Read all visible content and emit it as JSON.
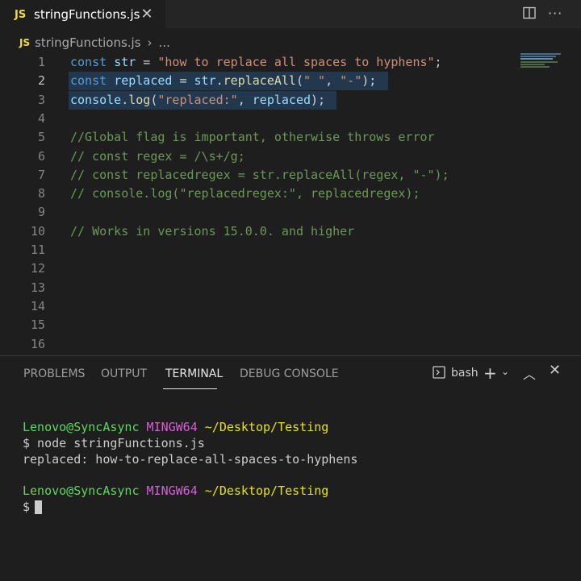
{
  "tab": {
    "badge": "JS",
    "filename": "stringFunctions.js",
    "close_icon": "close-icon"
  },
  "actions": {
    "split_icon": "split-editor-icon",
    "more_icon": "more-actions-icon"
  },
  "breadcrumb": {
    "badge": "JS",
    "file": "stringFunctions.js",
    "ellipsis": "..."
  },
  "editor": {
    "active_line": 2,
    "lines": [
      {
        "n": "1",
        "tokens": [
          {
            "t": "const",
            "c": "kw"
          },
          {
            "t": " ",
            "c": "pl"
          },
          {
            "t": "str",
            "c": "var"
          },
          {
            "t": " = ",
            "c": "pl"
          },
          {
            "t": "\"how to replace all spaces to hyphens\"",
            "c": "str"
          },
          {
            "t": ";",
            "c": "pl"
          }
        ]
      },
      {
        "n": "2",
        "tokens": [
          {
            "t": "const",
            "c": "kw"
          },
          {
            "t": " ",
            "c": "pl"
          },
          {
            "t": "replaced",
            "c": "var"
          },
          {
            "t": " = ",
            "c": "pl"
          },
          {
            "t": "str",
            "c": "var"
          },
          {
            "t": ".",
            "c": "pl"
          },
          {
            "t": "replaceAll",
            "c": "fn"
          },
          {
            "t": "(",
            "c": "pl"
          },
          {
            "t": "\" \"",
            "c": "str"
          },
          {
            "t": ", ",
            "c": "pl"
          },
          {
            "t": "\"-\"",
            "c": "str"
          },
          {
            "t": ");",
            "c": "pl"
          }
        ]
      },
      {
        "n": "3",
        "tokens": [
          {
            "t": "console",
            "c": "var"
          },
          {
            "t": ".",
            "c": "pl"
          },
          {
            "t": "log",
            "c": "fn"
          },
          {
            "t": "(",
            "c": "pl"
          },
          {
            "t": "\"replaced:\"",
            "c": "str"
          },
          {
            "t": ", ",
            "c": "pl"
          },
          {
            "t": "replaced",
            "c": "var"
          },
          {
            "t": ");",
            "c": "pl"
          }
        ]
      },
      {
        "n": "4",
        "tokens": []
      },
      {
        "n": "5",
        "tokens": [
          {
            "t": "//Global flag is important, otherwise throws error",
            "c": "cm"
          }
        ]
      },
      {
        "n": "6",
        "tokens": [
          {
            "t": "// const regex = /\\s+/g;",
            "c": "cm"
          }
        ]
      },
      {
        "n": "7",
        "tokens": [
          {
            "t": "// const replacedregex = str.replaceAll(regex, \"-\");",
            "c": "cm"
          }
        ]
      },
      {
        "n": "8",
        "tokens": [
          {
            "t": "// console.log(\"replacedregex:\", replacedregex);",
            "c": "cm"
          }
        ]
      },
      {
        "n": "9",
        "tokens": []
      },
      {
        "n": "10",
        "tokens": [
          {
            "t": "// Works in versions 15.0.0. and higher",
            "c": "cm"
          }
        ]
      },
      {
        "n": "11",
        "tokens": []
      },
      {
        "n": "12",
        "tokens": []
      },
      {
        "n": "13",
        "tokens": []
      },
      {
        "n": "14",
        "tokens": []
      },
      {
        "n": "15",
        "tokens": []
      },
      {
        "n": "16",
        "tokens": []
      }
    ]
  },
  "panel": {
    "tabs": {
      "problems": "PROBLEMS",
      "output": "OUTPUT",
      "terminal": "TERMINAL",
      "debug": "DEBUG CONSOLE"
    },
    "active_tab": "TERMINAL",
    "shell": "bash",
    "icons": {
      "terminal": "terminal-icon",
      "plus": "plus-icon",
      "chevron": "chevron-down-icon",
      "maximize": "chevron-up-icon",
      "close": "close-icon"
    }
  },
  "terminal": {
    "prompt1": {
      "user": "Lenovo@SyncAsync",
      "host": "MINGW64",
      "path": "~/Desktop/Testing"
    },
    "command": "$ node stringFunctions.js",
    "output": "replaced: how-to-replace-all-spaces-to-hyphens",
    "prompt2": {
      "user": "Lenovo@SyncAsync",
      "host": "MINGW64",
      "path": "~/Desktop/Testing"
    },
    "input_prompt": "$"
  },
  "colors": {
    "keyword": "#569cd6",
    "variable": "#9cdcfe",
    "function": "#dcdcaa",
    "string": "#ce9178",
    "comment": "#6a9955",
    "js_badge": "#f1dd3f"
  }
}
